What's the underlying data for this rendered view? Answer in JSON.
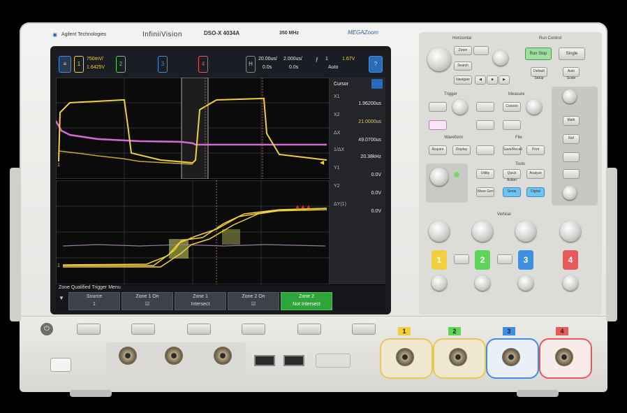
{
  "brand": {
    "company": "Agilent Technologies",
    "series": "InfiniiVision",
    "model": "DSO-X 4034A",
    "bandwidth": "350 MHz"
  },
  "topbar": {
    "ch1_scale": "750mV/",
    "ch1_offset": "1.6425V",
    "time_scale_1": "20.00us/",
    "time_delay_1": "0.0s",
    "time_scale_2": "2.000us/",
    "time_delay_2": "0.0s",
    "trigger_count": "1",
    "trigger_mode": "Auto",
    "trigger_level": "1.67V"
  },
  "sidepanel": {
    "header": "Cursor",
    "rows": [
      {
        "label": "X1",
        "value": "1.96200us"
      },
      {
        "label": "X2",
        "value": "21.0000us"
      },
      {
        "label": "ΔX",
        "value": "49.0700us"
      },
      {
        "label": "1/ΔX",
        "value": "20.38kHz"
      },
      {
        "label": "Y1",
        "value": "0.0V"
      },
      {
        "label": "Y2",
        "value": "0.0V"
      },
      {
        "label": "ΔY(1)",
        "value": "0.0V"
      }
    ]
  },
  "zone_menu": {
    "title": "Zone Qualified Trigger Menu",
    "keys": [
      {
        "top": "Source",
        "bottom": "1"
      },
      {
        "top": "Zone 1 On",
        "bottom": ""
      },
      {
        "top": "Zone 1",
        "bottom": "Intersect"
      },
      {
        "top": "Zone 2 On",
        "bottom": ""
      },
      {
        "top": "Zone 2",
        "bottom": "Not Intersect"
      }
    ]
  },
  "controls": {
    "horizontal": "Horizontal",
    "run_control": "Run Control",
    "run_stop": "Run Stop",
    "single": "Single",
    "trigger": "Trigger",
    "measure": "Measure",
    "waveform": "Waveform",
    "file": "File",
    "tools": "Tools",
    "vertical": "Vertical",
    "zoom": "Zoom",
    "navigate": "Navigate",
    "search": "Search",
    "menu": "Menu",
    "acquire": "Acquire",
    "display": "Display",
    "default": "Default Setup",
    "auto": "Auto Scale",
    "level": "Level",
    "cursors": "Cursors",
    "save": "Save/Recall",
    "print": "Print",
    "utility": "Utility",
    "quick_action": "Quick Action",
    "analyze": "Analyze",
    "wavegen": "Wave Gen",
    "math": "Math",
    "ref": "Ref",
    "digital": "Digital",
    "serial": "Serial"
  },
  "channels": [
    "1",
    "2",
    "3",
    "4"
  ],
  "colors": {
    "ch1": "#f2cf3c",
    "ch2": "#5fd35a",
    "ch3": "#3e8fe0",
    "ch4": "#e85a5a",
    "math": "#d06bd6",
    "zone": "#9aa14a"
  }
}
